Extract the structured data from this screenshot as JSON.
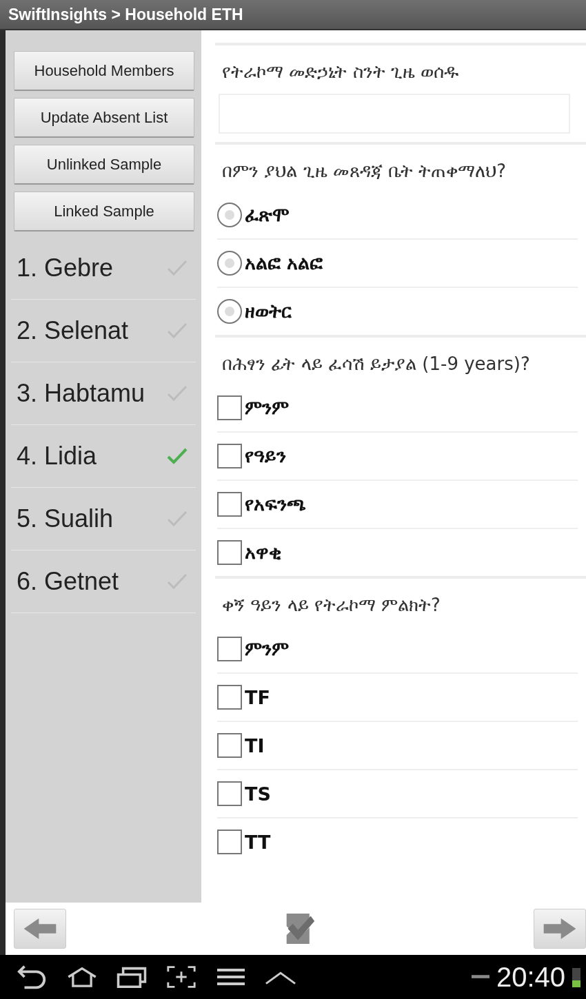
{
  "window": {
    "title": "SwiftInsights > Household ETH"
  },
  "sidebar": {
    "buttons": [
      "Household Members",
      "Update Absent List",
      "Unlinked Sample",
      "Linked Sample"
    ],
    "members": [
      {
        "label": "1.  Gebre",
        "checked": false
      },
      {
        "label": "2. Selenat",
        "checked": false
      },
      {
        "label": "3. Habtamu",
        "checked": false
      },
      {
        "label": "4. Lidia",
        "checked": true
      },
      {
        "label": "5. Sualih",
        "checked": false
      },
      {
        "label": "6. Getnet",
        "checked": false
      }
    ]
  },
  "questions": [
    {
      "kind": "text",
      "prompt": "የትራኮማ መድኃኒት ስንት ጊዜ ወሰዱ"
    },
    {
      "kind": "radio",
      "prompt": "በምን ያህል ጊዜ መጸዳጃ ቤት ትጠቀማለህ?",
      "options": [
        {
          "label": "ፈጽሞ",
          "selected": false
        },
        {
          "label": "አልፎ አልፎ",
          "selected": false
        },
        {
          "label": "ዘወትር",
          "selected": false
        }
      ]
    },
    {
      "kind": "checkbox",
      "prompt": "በሕፃን ፊት ላይ ፈሳሽ ይታያል (1-9 years)?",
      "options": [
        {
          "label": "ምንም",
          "checked": false
        },
        {
          "label": "የዓይን",
          "checked": false
        },
        {
          "label": "የአፍንጫ",
          "checked": false
        },
        {
          "label": "አዋቂ",
          "checked": false
        }
      ]
    },
    {
      "kind": "checkbox",
      "prompt": "ቀኝ ዓይን ላይ የትራኮማ ምልክት?",
      "options": [
        {
          "label": "ምንም",
          "checked": false
        },
        {
          "label": "TF",
          "checked": false
        },
        {
          "label": "TI",
          "checked": false
        },
        {
          "label": "TS",
          "checked": false
        },
        {
          "label": "TT",
          "checked": false
        }
      ]
    }
  ],
  "status_bar": {
    "time": "20:40"
  }
}
